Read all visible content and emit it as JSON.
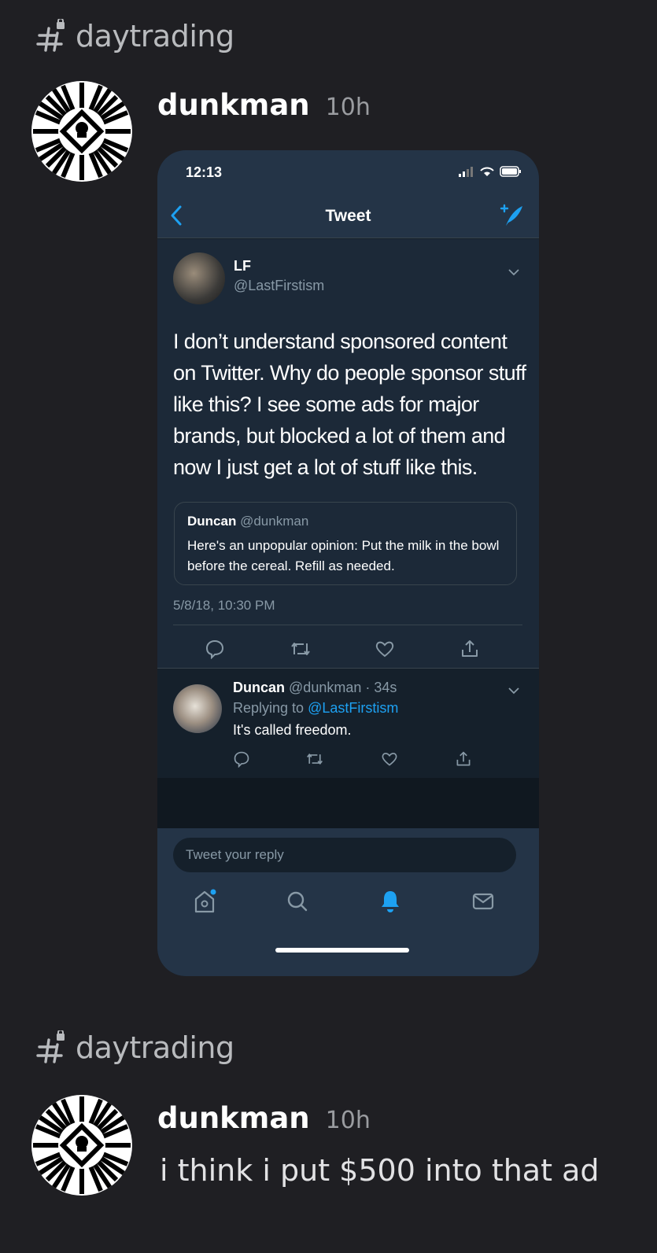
{
  "messages": [
    {
      "channel": "daytrading",
      "user": "dunkman",
      "time": "10h"
    },
    {
      "channel": "daytrading",
      "user": "dunkman",
      "time": "10h",
      "text": "i think i put $500 into that ad"
    }
  ],
  "phone": {
    "clock": "12:13",
    "nav_title": "Tweet",
    "tweet": {
      "name": "LF",
      "handle": "@LastFirstism",
      "text": "I don’t understand sponsored content on Twitter.  Why do people sponsor stuff like this? I see some ads for major brands, but blocked a lot of them and now I just get a lot of stuff like this.",
      "quote": {
        "name": "Duncan",
        "handle": "@dunkman",
        "text": "Here's an unpopular opinion:  Put the milk in the bowl before the cereal.  Refill as needed."
      },
      "date": "5/8/18, 10:30 PM"
    },
    "reply": {
      "name": "Duncan",
      "handle": "@dunkman · 34s",
      "replying_prefix": "Replying to ",
      "replying_to": "@LastFirstism",
      "text": "It's called freedom."
    },
    "reply_placeholder": "Tweet your reply"
  },
  "colors": {
    "background": "#1f1f23",
    "twitter_blue": "#1da1f2",
    "phone_bg": "#15202b",
    "phone_bar": "#243447"
  }
}
